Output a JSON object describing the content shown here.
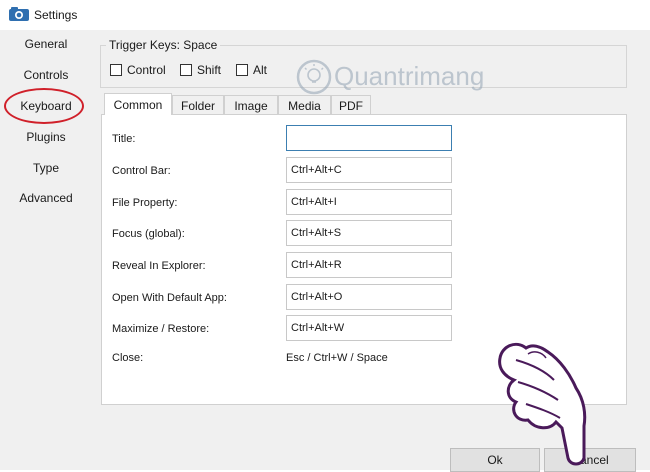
{
  "window": {
    "title": "Settings"
  },
  "sidebar": {
    "items": [
      {
        "label": "General"
      },
      {
        "label": "Controls"
      },
      {
        "label": "Keyboard"
      },
      {
        "label": "Plugins"
      },
      {
        "label": "Type"
      },
      {
        "label": "Advanced"
      }
    ],
    "selected": "Keyboard"
  },
  "annotation": {
    "number": "1",
    "color": "#d0202a"
  },
  "trigger": {
    "label": "Trigger Keys: Space",
    "options": [
      {
        "label": "Control",
        "checked": false
      },
      {
        "label": "Shift",
        "checked": false
      },
      {
        "label": "Alt",
        "checked": false
      }
    ]
  },
  "tabs": [
    {
      "label": "Common",
      "active": true
    },
    {
      "label": "Folder"
    },
    {
      "label": "Image"
    },
    {
      "label": "Media"
    },
    {
      "label": "PDF"
    }
  ],
  "shortcuts": [
    {
      "label": "Title:",
      "value": ""
    },
    {
      "label": "Control Bar:",
      "value": "Ctrl+Alt+C"
    },
    {
      "label": "File Property:",
      "value": "Ctrl+Alt+I"
    },
    {
      "label": "Focus (global):",
      "value": "Ctrl+Alt+S"
    },
    {
      "label": "Reveal In Explorer:",
      "value": "Ctrl+Alt+R"
    },
    {
      "label": "Open With Default App:",
      "value": "Ctrl+Alt+O"
    },
    {
      "label": "Maximize / Restore:",
      "value": "Ctrl+Alt+W"
    }
  ],
  "close": {
    "label": "Close:",
    "value": "Esc / Ctrl+W / Space"
  },
  "buttons": {
    "ok": "Ok",
    "cancel": "Cancel"
  },
  "watermark": {
    "text": "Quantrimang"
  },
  "icons": {
    "app": "camera-folder-icon",
    "watermark": "lightbulb-icon",
    "cursor": "pointing-hand-icon"
  },
  "colors": {
    "accent": "#3c7fb1",
    "annotation": "#d0202a",
    "panel_bg": "#f0f0f0"
  }
}
